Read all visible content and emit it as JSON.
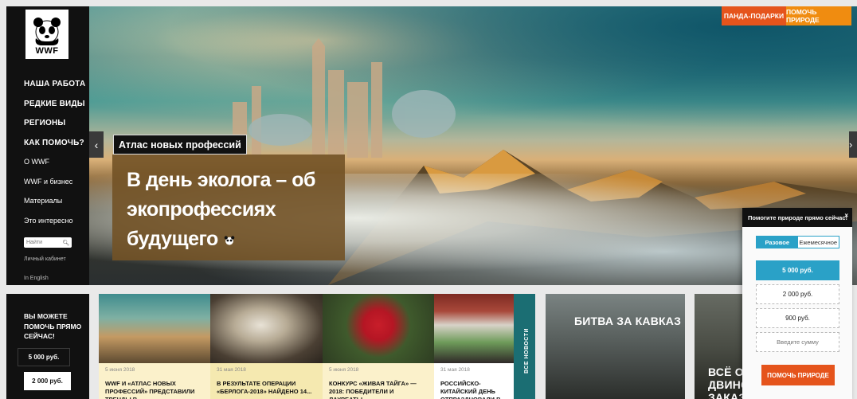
{
  "logo": {
    "text": "WWF"
  },
  "nav": {
    "items": [
      "НАША РАБОТА",
      "РЕДКИЕ ВИДЫ",
      "РЕГИОНЫ",
      "КАК ПОМОЧЬ?"
    ],
    "sub_items": [
      "О WWF",
      "WWF и бизнес",
      "Материалы",
      "Это интересно"
    ]
  },
  "search": {
    "placeholder": "Найти"
  },
  "links": {
    "cabinet": "Личный кабинет",
    "english": "In English"
  },
  "top_links": {
    "gifts": "ПАНДА-ПОДАРКИ",
    "help": "ПОМОЧЬ ПРИРОДЕ"
  },
  "hero": {
    "tag": "Атлас новых профессий",
    "headline_lines": [
      "В день эколога – об",
      "экопрофессиях",
      "будущего"
    ]
  },
  "donate_left": {
    "title_lines": [
      "ВЫ МОЖЕТЕ",
      "ПОМОЧЬ ПРЯМО",
      "СЕЙЧАС!"
    ],
    "amounts": [
      "5 000 руб.",
      "2 000 руб."
    ]
  },
  "news": [
    {
      "date": "5 июня 2018",
      "title": "WWF И «АТЛАС НОВЫХ ПРОФЕССИЙ» ПРЕДСТАВИЛИ ТРЕНДЫ В..."
    },
    {
      "date": "31 мая 2018",
      "title": "В РЕЗУЛЬТАТЕ ОПЕРАЦИИ «БЕРЛОГА-2018» НАЙДЕНО 14..."
    },
    {
      "date": "5 июня 2018",
      "title": "КОНКУРС «ЖИВАЯ ТАЙГА» — 2018: ПОБЕДИТЕЛИ И ЛАУРЕАТЫ..."
    },
    {
      "date": "31 мая 2018",
      "title": "РОССИЙСКО-КИТАЙСКИЙ ДЕНЬ ОТПРАЗДНОВАЛИ В ЗАПОВЕ..."
    }
  ],
  "news_tab": "ВСЕ НОВОСТИ",
  "features": [
    {
      "title_lines": [
        "БИТВА ЗА КАВКАЗ"
      ]
    },
    {
      "title_lines": [
        "ВСЁ О С",
        "ДВИНС",
        "ЗАКАЗ"
      ]
    }
  ],
  "popup": {
    "title": "Помогите природе прямо сейчас!",
    "close": "×",
    "tabs": [
      "Разовое",
      "Ежемесячное"
    ],
    "amounts": [
      "5 000 руб.",
      "2 000 руб.",
      "900 руб."
    ],
    "custom_placeholder": "Введите сумму",
    "button": "ПОМОЧЬ ПРИРОДЕ"
  },
  "arrows": {
    "prev": "‹",
    "next": "›"
  },
  "colors": {
    "orange": "#e5541c",
    "amber": "#f08c10",
    "blue": "#2aa1c7",
    "teal": "#1b6e73",
    "brown": "#725226"
  }
}
